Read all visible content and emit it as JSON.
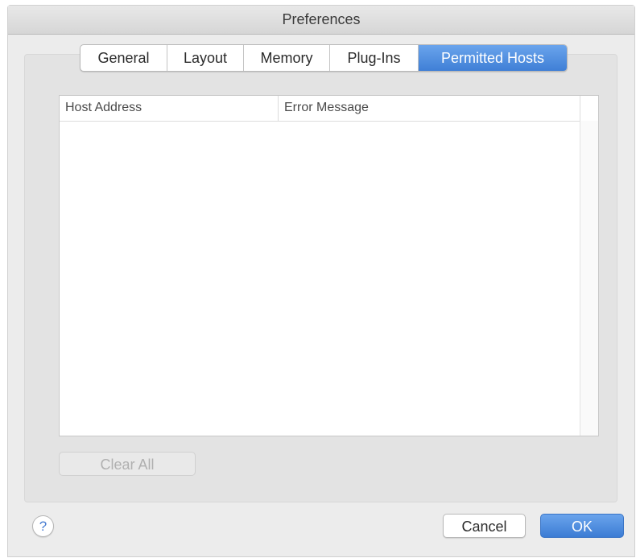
{
  "window": {
    "title": "Preferences"
  },
  "tabs": [
    {
      "label": "General",
      "active": false
    },
    {
      "label": "Layout",
      "active": false
    },
    {
      "label": "Memory",
      "active": false
    },
    {
      "label": "Plug-Ins",
      "active": false
    },
    {
      "label": "Permitted Hosts",
      "active": true
    }
  ],
  "table": {
    "columns": [
      "Host Address",
      "Error Message"
    ],
    "rows": []
  },
  "buttons": {
    "clear_all": "Clear All",
    "cancel": "Cancel",
    "ok": "OK",
    "help": "?"
  },
  "colors": {
    "accent": "#4a86dc",
    "window_bg": "#ececec",
    "disabled_text": "#b0b0b0"
  }
}
